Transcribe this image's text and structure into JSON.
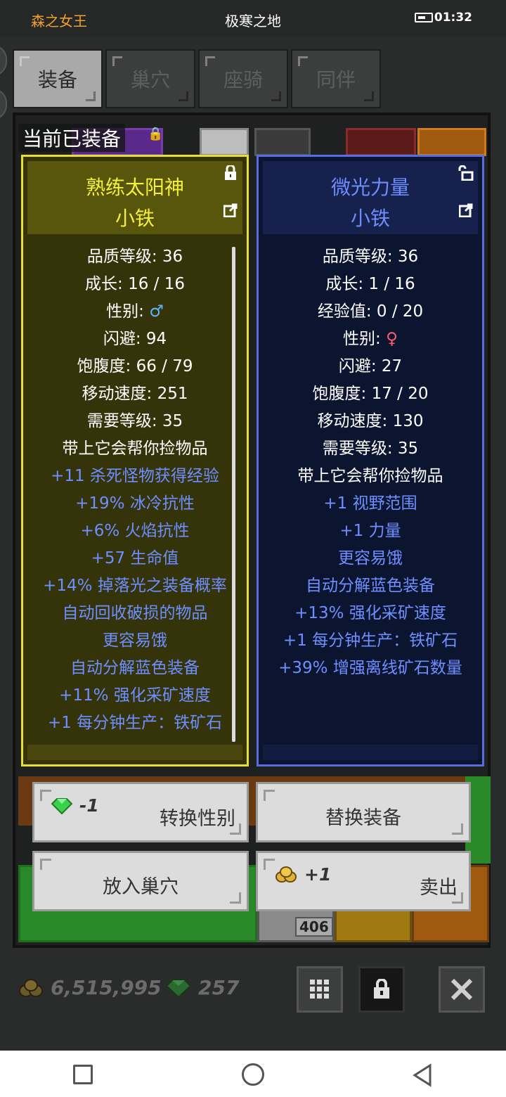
{
  "status_bar": {
    "app_name": "森之女王",
    "title": "极寒之地",
    "time": "01:32"
  },
  "tabs": [
    {
      "label": "装备",
      "active": true
    },
    {
      "label": "巢穴",
      "active": false
    },
    {
      "label": "座骑",
      "active": false
    },
    {
      "label": "同伴",
      "active": false
    }
  ],
  "equipped_title": "当前已装备",
  "left_pet": {
    "name": "熟练太阳神",
    "species": "小铁",
    "locked": true,
    "stats": [
      {
        "text": "品质等级: 36"
      },
      {
        "text": "成长: 16 / 16"
      },
      {
        "label": "性别: ",
        "symbol": "♂"
      },
      {
        "text": "闪避: 94"
      },
      {
        "text": "饱腹度: 66 / 79"
      },
      {
        "text": "移动速度: 251"
      },
      {
        "text": "需要等级: 35"
      },
      {
        "text": "带上它会帮你捡物品"
      }
    ],
    "bonuses": [
      "+11 杀死怪物获得经验",
      "+19% 冰冷抗性",
      "+6% 火焰抗性",
      "+57 生命值",
      "+14% 掉落光之装备概率",
      "自动回收破损的物品",
      "更容易饿",
      "自动分解蓝色装备",
      "+11% 强化采矿速度",
      "+1 每分钟生产：铁矿石"
    ]
  },
  "right_pet": {
    "name": "微光力量",
    "species": "小铁",
    "locked": false,
    "stats": [
      {
        "text": "品质等级: 36"
      },
      {
        "text": "成长: 1 / 16"
      },
      {
        "text": "经验值: 0 / 20"
      },
      {
        "label": "性别: ",
        "symbol": "♀"
      },
      {
        "text": "闪避: 27"
      },
      {
        "text": "饱腹度: 17 / 20"
      },
      {
        "text": "移动速度: 130"
      },
      {
        "text": "需要等级: 35"
      },
      {
        "text": "带上它会帮你捡物品"
      }
    ],
    "bonuses": [
      "+1 视野范围",
      "+1 力量",
      "更容易饿",
      "自动分解蓝色装备",
      "+13% 强化采矿速度",
      "+1 每分钟生产：铁矿石",
      "+39% 增强离线矿石数量"
    ]
  },
  "actions": {
    "switch_gender": {
      "cost": "-1",
      "label": "转换性别"
    },
    "replace": {
      "label": "替换装备"
    },
    "to_nest": {
      "label": "放入巢穴"
    },
    "sell": {
      "reward": "+1",
      "label": "卖出"
    }
  },
  "inventory_badge": "406",
  "currency": {
    "gold": "6,515,995",
    "gems": "257"
  },
  "colors": {
    "gem_green": "#3ad24a",
    "gold": "#e0b43a",
    "rarity_yellow": "#e8e030",
    "rarity_blue": "#5b6ce0"
  }
}
